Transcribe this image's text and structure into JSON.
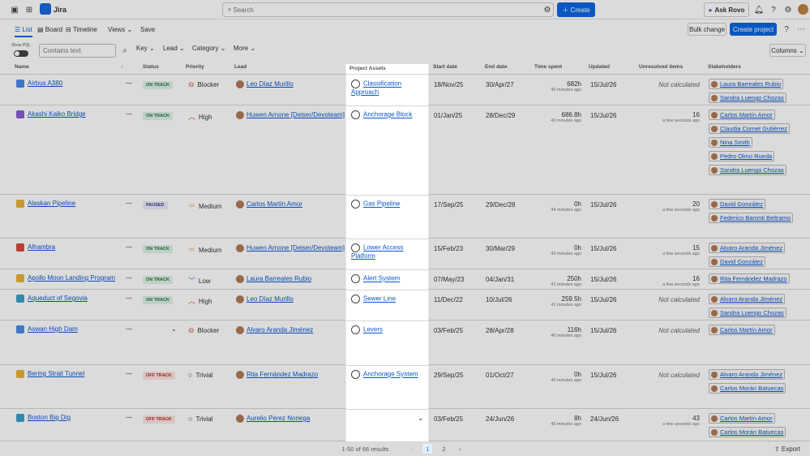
{
  "app": {
    "name": "Jira"
  },
  "search": {
    "placeholder": "Search"
  },
  "topbar": {
    "create_label": "Create",
    "rovo_label": "Ask Rovo"
  },
  "toolbar": {
    "tabs": [
      {
        "label": "List"
      },
      {
        "label": "Board"
      },
      {
        "label": "Timeline"
      }
    ],
    "views_label": "Views",
    "save_label": "Save",
    "bulk_change_label": "Bulk change",
    "create_project_label": "Create project"
  },
  "filters": {
    "show_pql_label": "Show PQL",
    "text_placeholder": "Contains text",
    "key_label": "Key",
    "lead_label": "Lead",
    "category_label": "Category",
    "more_label": "More",
    "columns_label": "Columns"
  },
  "columns": {
    "name": "Name",
    "status": "Status",
    "priority": "Priority",
    "lead": "Lead",
    "assets": "Project Assets",
    "start": "Start date",
    "end": "End date",
    "time": "Time spent",
    "updated": "Updated",
    "unresolved": "Unresolved items",
    "stakeholders": "Stakeholders"
  },
  "rows": [
    {
      "name": "Airbus A380",
      "status": "ON TRACK",
      "priority": "Blocker",
      "lead": "Leo Díaz Murillo",
      "asset": "Classification Approach",
      "start": "18/Nov/25",
      "end": "30/Apr/27",
      "time": "682h",
      "time_sub": "40 minutes ago",
      "updated": "15/Jul/26",
      "unresolved": "Not calculated",
      "unresolved_sub": "",
      "stakeholders": [
        "Laura Barreales Rubio",
        "Sandra Luengo Chozas"
      ]
    },
    {
      "name": "Akashi Kaiko Bridge",
      "status": "ON TRACK",
      "priority": "High",
      "lead": "Huwen Arnone [Deiser/Devoteam]",
      "asset": "Anchorage Block",
      "start": "01/Jan/25",
      "end": "28/Dec/29",
      "time": "686.8h",
      "time_sub": "43 minutes ago",
      "updated": "15/Jul/26",
      "unresolved": "16",
      "unresolved_sub": "a few seconds ago",
      "stakeholders": [
        "Carlos Martín Amor",
        "Claudia Cornet Gutiérrez",
        "Nina Smith",
        "Pedro Olmo Rueda",
        "Sandra Luengo Chozas"
      ]
    },
    {
      "name": "Alaskan Pipeline",
      "status": "PAUSED",
      "priority": "Medium",
      "lead": "Carlos Martín Amor",
      "asset": "Gas Pipeline",
      "start": "17/Sep/25",
      "end": "29/Dec/28",
      "time": "0h",
      "time_sub": "44 minutes ago",
      "updated": "15/Jul/26",
      "unresolved": "20",
      "unresolved_sub": "a few seconds ago",
      "stakeholders": [
        "David González",
        "Federico Baronti Beltramo"
      ]
    },
    {
      "name": "Alhambra",
      "status": "ON TRACK",
      "priority": "Medium",
      "lead": "Huwen Arnone [Deiser/Devoteam]",
      "asset": "Lower Access Platform",
      "start": "15/Feb/23",
      "end": "30/Mar/29",
      "time": "0h",
      "time_sub": "43 minutes ago",
      "updated": "15/Jul/26",
      "unresolved": "15",
      "unresolved_sub": "a few seconds ago",
      "stakeholders": [
        "Alvaro Aranda Jiménez",
        "David González"
      ]
    },
    {
      "name": "Apollo Moon Landing Program",
      "status": "ON TRACK",
      "priority": "Low",
      "lead": "Laura Barreales Rubio",
      "asset": "Alert System",
      "start": "07/May/23",
      "end": "04/Jan/31",
      "time": "250h",
      "time_sub": "41 minutes ago",
      "updated": "15/Jul/26",
      "unresolved": "16",
      "unresolved_sub": "a few seconds ago",
      "stakeholders": [
        "Rita Fernández Madrazo"
      ]
    },
    {
      "name": "Aqueduct of Segovia",
      "status": "ON TRACK",
      "priority": "High",
      "lead": "Leo Díaz Murillo",
      "asset": "Sewer Line",
      "start": "11/Dec/22",
      "end": "10/Jul/26",
      "time": "259.5h",
      "time_sub": "41 minutes ago",
      "updated": "15/Jul/26",
      "unresolved": "Not calculated",
      "unresolved_sub": "",
      "stakeholders": [
        "Alvaro Aranda Jiménez",
        "Sandra Luengo Chozas"
      ]
    },
    {
      "name": "Aswan High Dam",
      "status": "",
      "priority": "Blocker",
      "lead": "Alvaro Aranda Jiménez",
      "asset": "Levers",
      "start": "03/Feb/25",
      "end": "28/Apr/28",
      "time": "116h",
      "time_sub": "40 minutes ago",
      "updated": "15/Jul/26",
      "unresolved": "Not calculated",
      "unresolved_sub": "",
      "stakeholders": [
        "Carlos Martín Amor"
      ]
    },
    {
      "name": "Bering Strait Tunnel",
      "status": "OFF TRACK",
      "priority": "Trivial",
      "lead": "Rita Fernández Madrazo",
      "asset": "Anchorage System",
      "start": "29/Sep/25",
      "end": "01/Oct/27",
      "time": "0h",
      "time_sub": "40 minutes ago",
      "updated": "15/Jul/26",
      "unresolved": "Not calculated",
      "unresolved_sub": "",
      "stakeholders": [
        "Alvaro Aranda Jiménez",
        "Carlos Morán Batuecas"
      ]
    },
    {
      "name": "Boston Big Dig",
      "status": "OFF TRACK",
      "priority": "Trivial",
      "lead": "Aurelio Pérez Noriega",
      "asset": "",
      "start": "03/Feb/25",
      "end": "24/Jun/26",
      "time": "8h",
      "time_sub": "45 minutes ago",
      "updated": "24/Jun/26",
      "unresolved": "43",
      "unresolved_sub": "a few seconds ago",
      "stakeholders": [
        "Carlos Martín Amor",
        "Carlos Morán Batuecas"
      ]
    }
  ],
  "pagination": {
    "summary": "1-50 of 66 results",
    "pages": [
      "1",
      "2"
    ],
    "export_label": "Export"
  }
}
